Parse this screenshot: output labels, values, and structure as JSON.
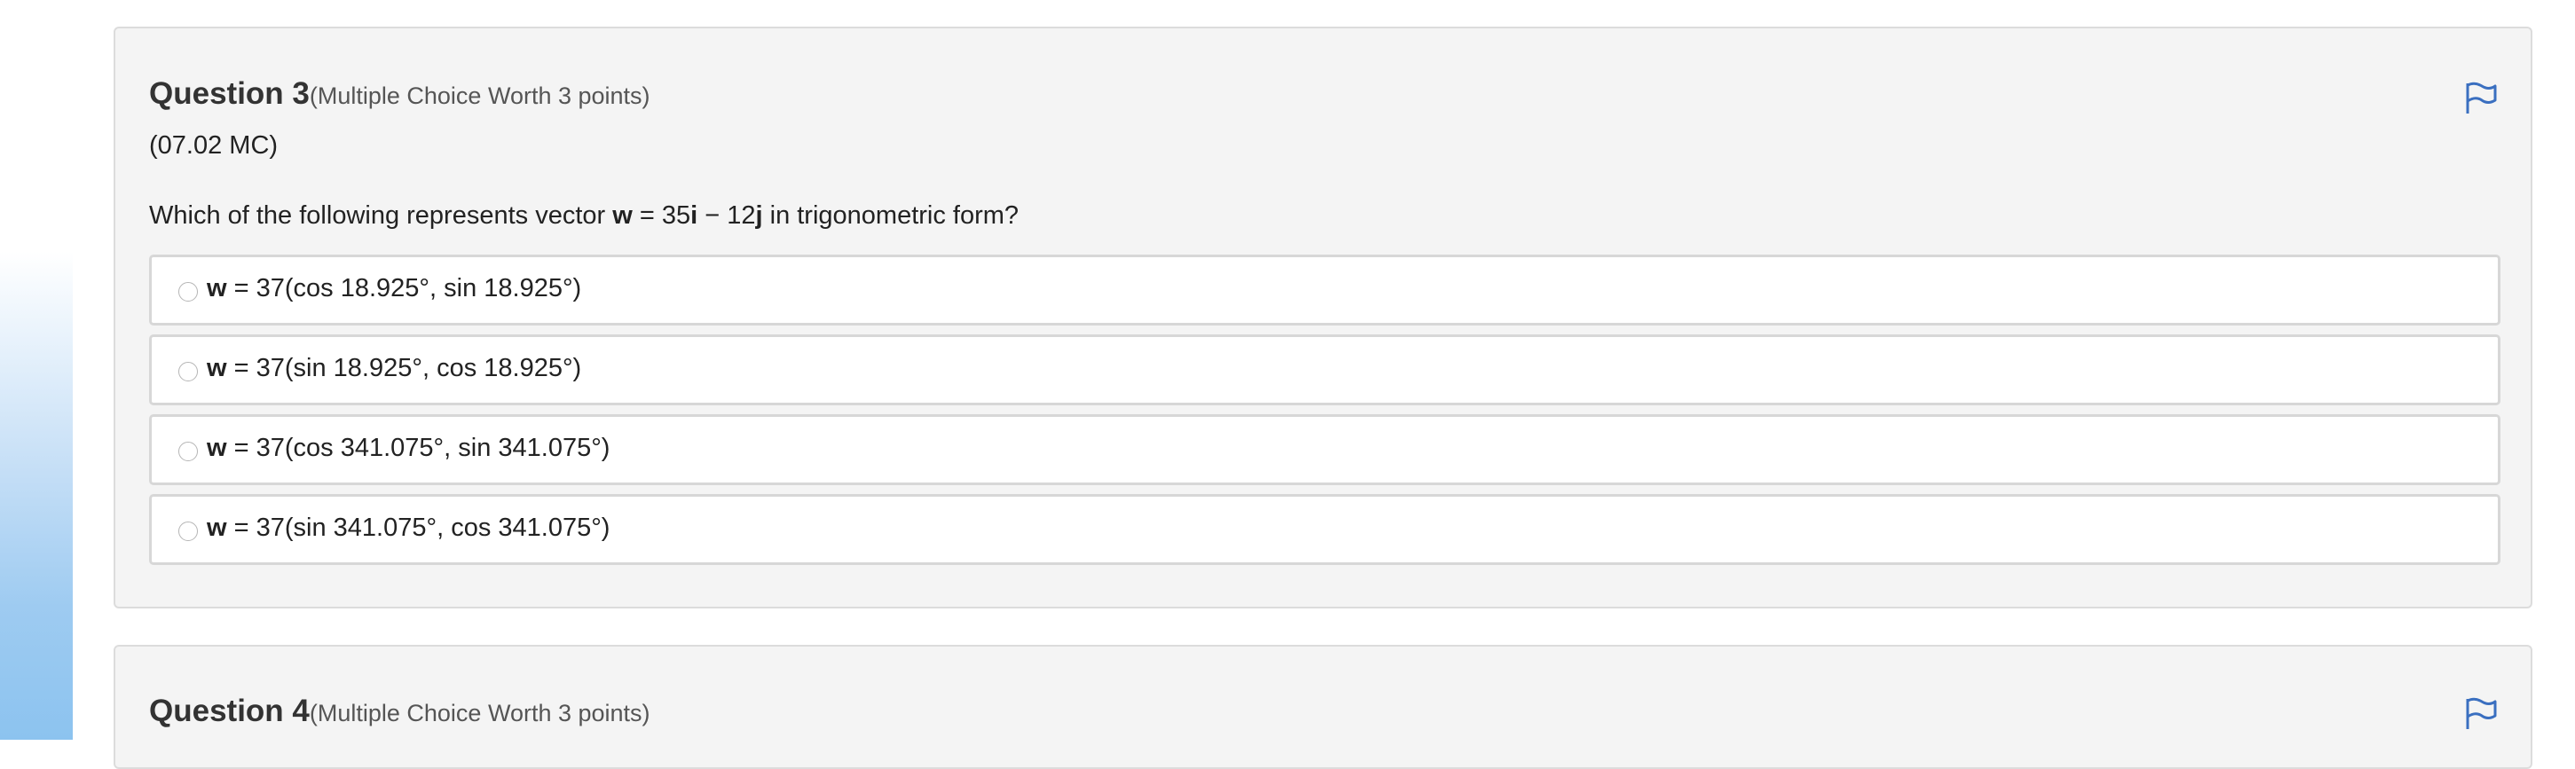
{
  "questions": [
    {
      "title": "Question 3",
      "points_label": "(Multiple Choice Worth 3 points)",
      "code": "(07.02 MC)",
      "prompt": {
        "prefix": "Which of the following represents vector ",
        "vector": "w",
        "equals": " = 35",
        "i": "i",
        "minus": " − 12",
        "j": "j",
        "suffix": " in trigonometric form?"
      },
      "options": [
        {
          "var": "w",
          "text": " = 37(cos 18.925°, sin 18.925°)"
        },
        {
          "var": "w",
          "text": " = 37(sin 18.925°, cos 18.925°)"
        },
        {
          "var": "w",
          "text": " = 37(cos 341.075°, sin 341.075°)"
        },
        {
          "var": "w",
          "text": " = 37(sin 341.075°, cos 341.075°)"
        }
      ],
      "flag_icon": "flag-icon"
    },
    {
      "title": "Question 4",
      "points_label": "(Multiple Choice Worth 3 points)",
      "flag_icon": "flag-icon"
    }
  ],
  "colors": {
    "card_bg": "#f4f4f4",
    "card_border": "#dcdcdc",
    "flag": "#3a6fc0",
    "option_border": "#d7d7d7"
  }
}
